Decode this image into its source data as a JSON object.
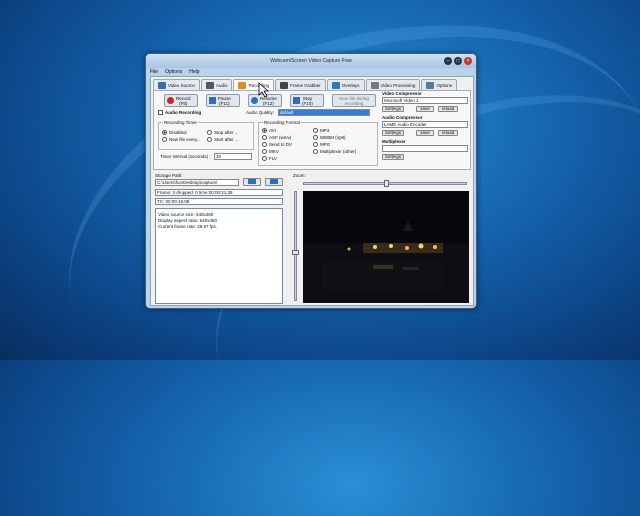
{
  "window": {
    "title": "Webcam/Screen Video Capture Free",
    "controls": [
      "–",
      "□",
      "×"
    ]
  },
  "menu": [
    "File",
    "Options",
    "Help"
  ],
  "tabs": [
    {
      "label": "Video Source",
      "icon": "video-source-icon",
      "active": false
    },
    {
      "label": "Audio",
      "icon": "microphone-icon",
      "active": false
    },
    {
      "label": "Recording",
      "icon": "recording-icon",
      "active": true
    },
    {
      "label": "Frame Grabber",
      "icon": "camera-icon",
      "active": false
    },
    {
      "label": "Overlays",
      "icon": "overlay-icon",
      "active": false
    },
    {
      "label": "Video Processing",
      "icon": "processing-icon",
      "active": false
    },
    {
      "label": "Options",
      "icon": "tools-icon",
      "active": false
    }
  ],
  "controls": {
    "record": {
      "label": "Record",
      "key": "(F5)"
    },
    "pause": {
      "label": "Pause",
      "key": "(F11)"
    },
    "resume": {
      "label": "Resume",
      "key": "(F12)"
    },
    "stop": {
      "label": "Stop",
      "key": "(F10)"
    },
    "new_file": {
      "label": "New file during recording"
    }
  },
  "audio_recording": {
    "label": "Audio Recording",
    "quality_label": "Audio Quality:",
    "quality_value": "default"
  },
  "recording_timer": {
    "title": "Recording Timer",
    "options": [
      "Disabled",
      "New file every...",
      "Stop after ...",
      "Start after ..."
    ],
    "interval_label": "Timer interval (seconds) :",
    "interval_value": "30"
  },
  "recording_format": {
    "title": "Recording Format",
    "options": [
      "AVI",
      "ASF (wmv)",
      "Send to DV",
      "MKV",
      "FLV",
      "MP4",
      "WEBM (vp8)",
      "MPG",
      "Multiplexer (other)"
    ]
  },
  "video_compressor": {
    "title": "Video Compressor",
    "value": "Microsoft Video 1",
    "buttons": [
      "Settings",
      "save",
      "reload"
    ]
  },
  "audio_compressor": {
    "title": "Audio Compressor",
    "value": "LAME Audio Encoder",
    "buttons": [
      "Settings",
      "save",
      "reload"
    ]
  },
  "multiplexer": {
    "title": "Multiplexer",
    "button": "Settings"
  },
  "storage": {
    "label": "Storage Path:",
    "path": "C:\\Users\\fun\\Desktop\\capture\\",
    "stats": "Frame: 3 dropped: 0 time:00:00:21.35",
    "tc": "TC: 00:00:19.08",
    "info": [
      "Video source size: 640x480",
      "Display aspect ratio: 640x480",
      "Current frame rate: 29.97 fps."
    ]
  },
  "zoom": {
    "label": "Zoom:"
  }
}
